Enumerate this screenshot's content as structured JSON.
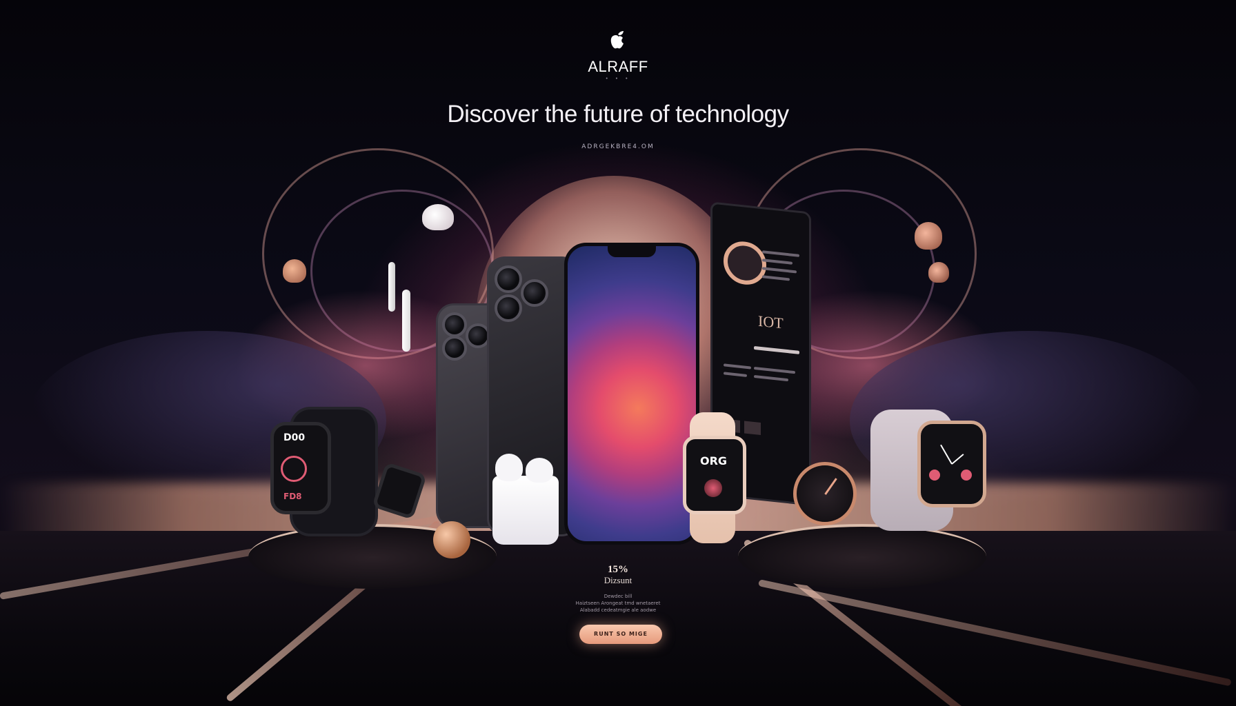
{
  "header": {
    "logo_icon": "apple-logo-icon",
    "brand": "ALRAFF",
    "brand_sub": "• • •",
    "headline": "Discover the future of technology",
    "url": "ADRGEKBRE4.OM"
  },
  "promo": {
    "percent": "15%",
    "label": "Dizsunt",
    "fine_line_1": "Dewdec bill",
    "fine_line_2": "Haiztseen Arongeat tmd wnetaeret",
    "fine_line_3": "Alabadd cedeatmgie ale aodwe",
    "cta_label": "RUNT SO MIGE"
  },
  "devices": {
    "left_watch_time": "D00",
    "left_watch_bottom": "FD8",
    "center_watch_label": "ORG",
    "tablet_heading": "IOT"
  },
  "colors": {
    "accent": "#f3b59c",
    "background": "#07060c",
    "screen_wallpaper": "#e44c6c"
  }
}
